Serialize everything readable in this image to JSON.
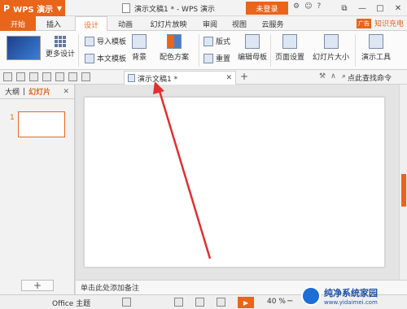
{
  "titlebar": {
    "app_button": "WPS 演示",
    "doc_title": "演示文稿1 * - WPS 演示",
    "login": "未登录"
  },
  "tabs": [
    "开始",
    "插入",
    "设计",
    "动画",
    "幻灯片放映",
    "审阅",
    "视图",
    "云服务"
  ],
  "active_tab": "设计",
  "ad_badge": "广告",
  "knowledge": "知识充电",
  "ribbon": {
    "more_design": "更多设计",
    "import_template": "导入模板",
    "text_template": "本文模板",
    "background": "背景",
    "color_scheme": "配色方案",
    "layout": "版式",
    "rearrange": "重置",
    "edit_master": "编辑母板",
    "page_setup": "页面设置",
    "slide_size": "幻灯片大小",
    "presentation_tools": "演示工具"
  },
  "doc_tab": "演示文稿1 *",
  "search_cmd": "点此查找命令",
  "leftpane": {
    "outline": "大纲",
    "slides": "幻灯片",
    "slide_number": "1"
  },
  "notes_placeholder": "单击此处添加备注",
  "status": {
    "theme": "Office 主题",
    "zoom": "40 %"
  },
  "watermark": {
    "title": "纯净系统家园",
    "url": "www.yidaimei.com"
  }
}
